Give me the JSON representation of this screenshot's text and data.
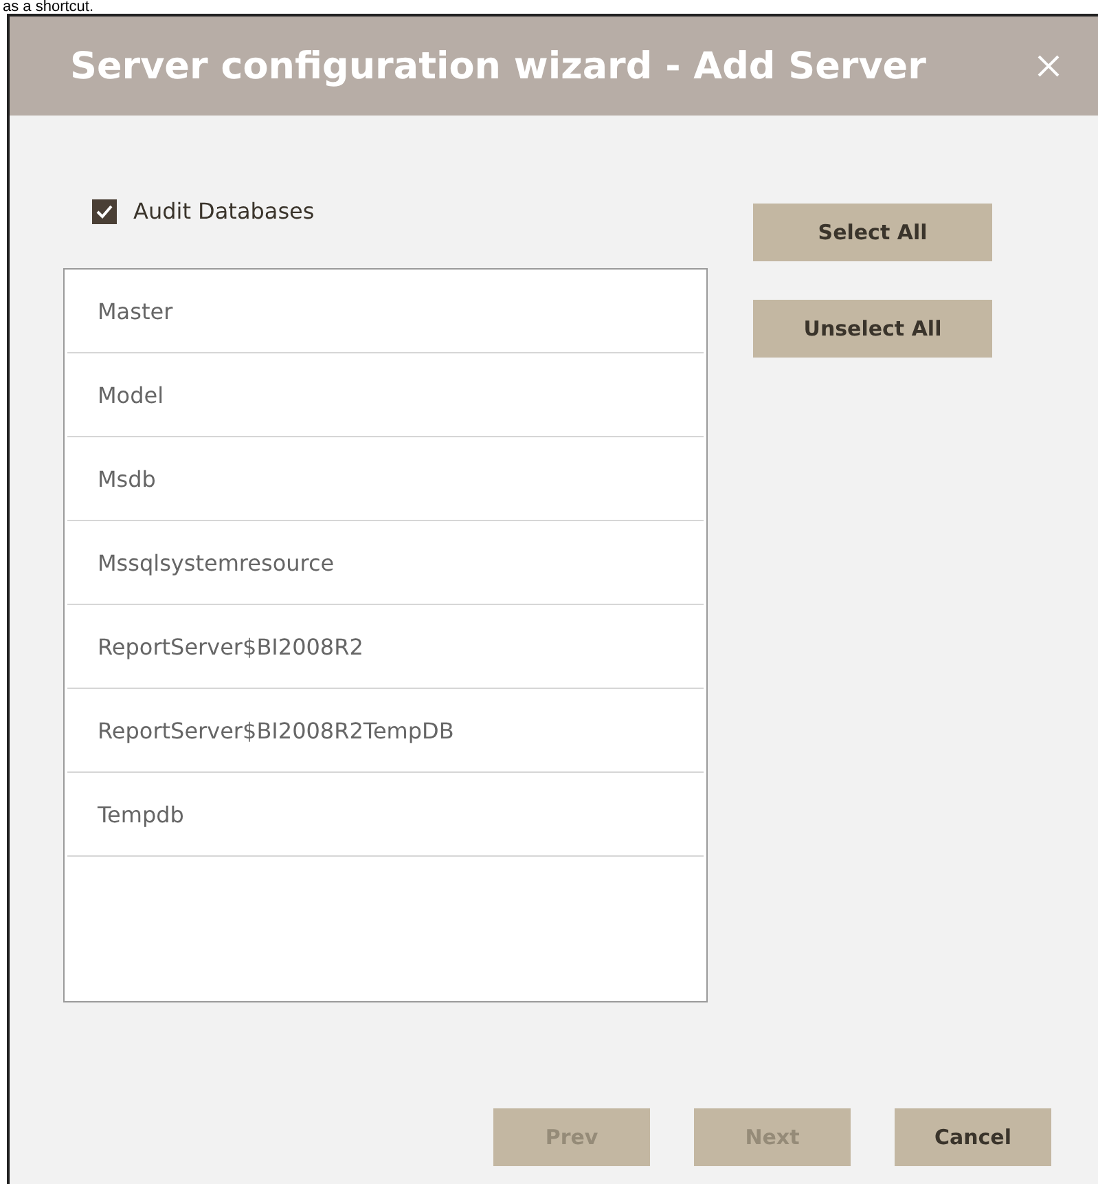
{
  "caption": "as a shortcut.",
  "window": {
    "title": "Server configuration wizard - Add Server"
  },
  "audit_databases": {
    "label": "Audit Databases",
    "checked": true
  },
  "side_buttons": [
    {
      "label": "Select All"
    },
    {
      "label": "Unselect All"
    }
  ],
  "databases": [
    "Master",
    "Model",
    "Msdb",
    "Mssqlsystemresource",
    "ReportServer$BI2008R2",
    "ReportServer$BI2008R2TempDB",
    "Tempdb"
  ],
  "footer_buttons": [
    {
      "label": "Prev",
      "disabled": true
    },
    {
      "label": "Next",
      "disabled": true
    },
    {
      "label": "Cancel",
      "disabled": false
    }
  ]
}
